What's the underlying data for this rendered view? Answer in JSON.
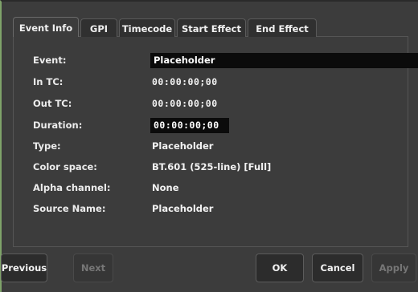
{
  "tabs": [
    {
      "label": "Event Info"
    },
    {
      "label": "GPI"
    },
    {
      "label": "Timecode"
    },
    {
      "label": "Start Effect"
    },
    {
      "label": "End Effect"
    }
  ],
  "active_tab": "Event Info",
  "fields": {
    "event": {
      "label": "Event:",
      "value": "Placeholder"
    },
    "in_tc": {
      "label": "In TC:",
      "value": "00:00:00;00"
    },
    "out_tc": {
      "label": "Out TC:",
      "value": "00:00:00;00"
    },
    "duration": {
      "label": "Duration:",
      "value": "00:00:00;00"
    },
    "type": {
      "label": "Type:",
      "value": "Placeholder"
    },
    "color_space": {
      "label": "Color space:",
      "value": "BT.601 (525-line) [Full]"
    },
    "alpha_channel": {
      "label": "Alpha channel:",
      "value": "None"
    },
    "source_name": {
      "label": "Source Name:",
      "value": "Placeholder"
    }
  },
  "buttons": {
    "previous": {
      "label": "Previous",
      "enabled": true
    },
    "next": {
      "label": "Next",
      "enabled": false
    },
    "ok": {
      "label": "OK",
      "enabled": true
    },
    "cancel": {
      "label": "Cancel",
      "enabled": true
    },
    "apply": {
      "label": "Apply",
      "enabled": false
    }
  },
  "colors": {
    "background": "#3c3c3c",
    "field_background": "#0b0b0b",
    "accent_border": "#7fa36a"
  }
}
